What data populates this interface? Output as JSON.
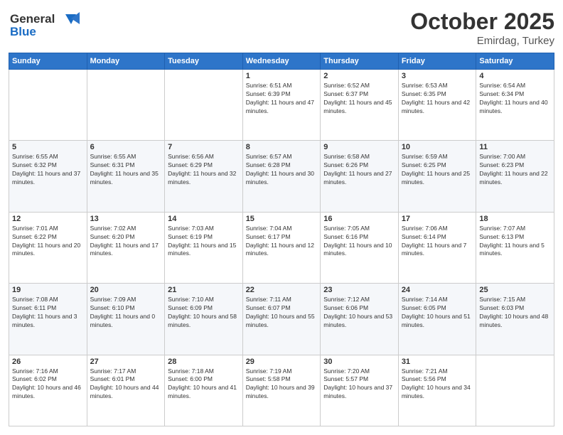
{
  "header": {
    "logo_line1": "General",
    "logo_line2": "Blue",
    "month": "October 2025",
    "location": "Emirdag, Turkey"
  },
  "days_of_week": [
    "Sunday",
    "Monday",
    "Tuesday",
    "Wednesday",
    "Thursday",
    "Friday",
    "Saturday"
  ],
  "weeks": [
    [
      {
        "day": "",
        "text": ""
      },
      {
        "day": "",
        "text": ""
      },
      {
        "day": "",
        "text": ""
      },
      {
        "day": "1",
        "text": "Sunrise: 6:51 AM\nSunset: 6:39 PM\nDaylight: 11 hours and 47 minutes."
      },
      {
        "day": "2",
        "text": "Sunrise: 6:52 AM\nSunset: 6:37 PM\nDaylight: 11 hours and 45 minutes."
      },
      {
        "day": "3",
        "text": "Sunrise: 6:53 AM\nSunset: 6:35 PM\nDaylight: 11 hours and 42 minutes."
      },
      {
        "day": "4",
        "text": "Sunrise: 6:54 AM\nSunset: 6:34 PM\nDaylight: 11 hours and 40 minutes."
      }
    ],
    [
      {
        "day": "5",
        "text": "Sunrise: 6:55 AM\nSunset: 6:32 PM\nDaylight: 11 hours and 37 minutes."
      },
      {
        "day": "6",
        "text": "Sunrise: 6:55 AM\nSunset: 6:31 PM\nDaylight: 11 hours and 35 minutes."
      },
      {
        "day": "7",
        "text": "Sunrise: 6:56 AM\nSunset: 6:29 PM\nDaylight: 11 hours and 32 minutes."
      },
      {
        "day": "8",
        "text": "Sunrise: 6:57 AM\nSunset: 6:28 PM\nDaylight: 11 hours and 30 minutes."
      },
      {
        "day": "9",
        "text": "Sunrise: 6:58 AM\nSunset: 6:26 PM\nDaylight: 11 hours and 27 minutes."
      },
      {
        "day": "10",
        "text": "Sunrise: 6:59 AM\nSunset: 6:25 PM\nDaylight: 11 hours and 25 minutes."
      },
      {
        "day": "11",
        "text": "Sunrise: 7:00 AM\nSunset: 6:23 PM\nDaylight: 11 hours and 22 minutes."
      }
    ],
    [
      {
        "day": "12",
        "text": "Sunrise: 7:01 AM\nSunset: 6:22 PM\nDaylight: 11 hours and 20 minutes."
      },
      {
        "day": "13",
        "text": "Sunrise: 7:02 AM\nSunset: 6:20 PM\nDaylight: 11 hours and 17 minutes."
      },
      {
        "day": "14",
        "text": "Sunrise: 7:03 AM\nSunset: 6:19 PM\nDaylight: 11 hours and 15 minutes."
      },
      {
        "day": "15",
        "text": "Sunrise: 7:04 AM\nSunset: 6:17 PM\nDaylight: 11 hours and 12 minutes."
      },
      {
        "day": "16",
        "text": "Sunrise: 7:05 AM\nSunset: 6:16 PM\nDaylight: 11 hours and 10 minutes."
      },
      {
        "day": "17",
        "text": "Sunrise: 7:06 AM\nSunset: 6:14 PM\nDaylight: 11 hours and 7 minutes."
      },
      {
        "day": "18",
        "text": "Sunrise: 7:07 AM\nSunset: 6:13 PM\nDaylight: 11 hours and 5 minutes."
      }
    ],
    [
      {
        "day": "19",
        "text": "Sunrise: 7:08 AM\nSunset: 6:11 PM\nDaylight: 11 hours and 3 minutes."
      },
      {
        "day": "20",
        "text": "Sunrise: 7:09 AM\nSunset: 6:10 PM\nDaylight: 11 hours and 0 minutes."
      },
      {
        "day": "21",
        "text": "Sunrise: 7:10 AM\nSunset: 6:09 PM\nDaylight: 10 hours and 58 minutes."
      },
      {
        "day": "22",
        "text": "Sunrise: 7:11 AM\nSunset: 6:07 PM\nDaylight: 10 hours and 55 minutes."
      },
      {
        "day": "23",
        "text": "Sunrise: 7:12 AM\nSunset: 6:06 PM\nDaylight: 10 hours and 53 minutes."
      },
      {
        "day": "24",
        "text": "Sunrise: 7:14 AM\nSunset: 6:05 PM\nDaylight: 10 hours and 51 minutes."
      },
      {
        "day": "25",
        "text": "Sunrise: 7:15 AM\nSunset: 6:03 PM\nDaylight: 10 hours and 48 minutes."
      }
    ],
    [
      {
        "day": "26",
        "text": "Sunrise: 7:16 AM\nSunset: 6:02 PM\nDaylight: 10 hours and 46 minutes."
      },
      {
        "day": "27",
        "text": "Sunrise: 7:17 AM\nSunset: 6:01 PM\nDaylight: 10 hours and 44 minutes."
      },
      {
        "day": "28",
        "text": "Sunrise: 7:18 AM\nSunset: 6:00 PM\nDaylight: 10 hours and 41 minutes."
      },
      {
        "day": "29",
        "text": "Sunrise: 7:19 AM\nSunset: 5:58 PM\nDaylight: 10 hours and 39 minutes."
      },
      {
        "day": "30",
        "text": "Sunrise: 7:20 AM\nSunset: 5:57 PM\nDaylight: 10 hours and 37 minutes."
      },
      {
        "day": "31",
        "text": "Sunrise: 7:21 AM\nSunset: 5:56 PM\nDaylight: 10 hours and 34 minutes."
      },
      {
        "day": "",
        "text": ""
      }
    ]
  ]
}
